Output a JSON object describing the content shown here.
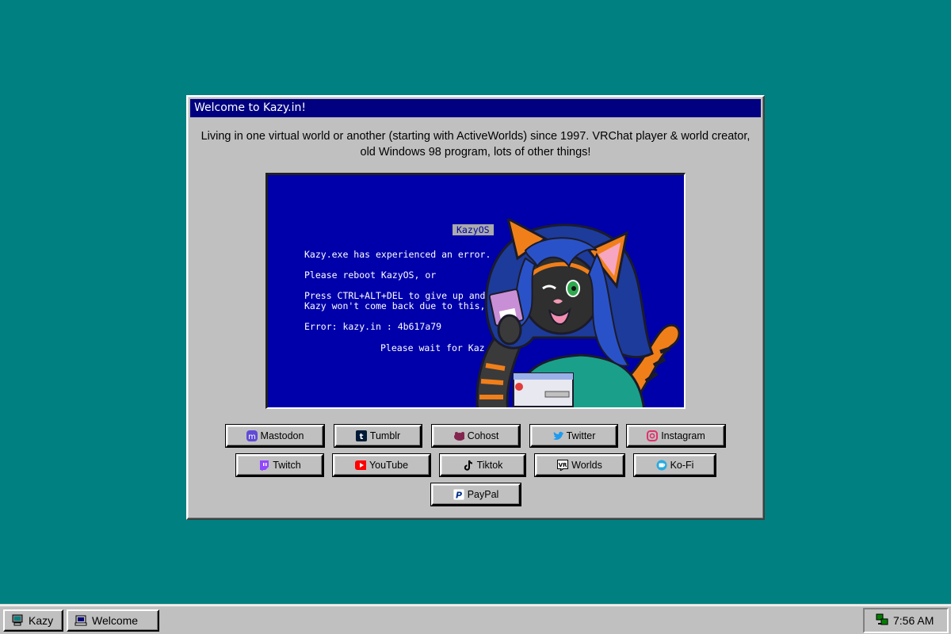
{
  "window": {
    "title": "Welcome to Kazy.in!",
    "intro": "Living in one virtual world or another (starting with ActiveWorlds) since 1997. VRChat player & world creator, old Windows 98 program, lots of other things!"
  },
  "screen": {
    "header": "KazyOS",
    "line1": "Kazy.exe has experienced an error.",
    "line2": "Please reboot KazyOS, or",
    "line3": "Press CTRL+ALT+DEL to give up and r",
    "line4": "Kazy won't come back due to this, bu",
    "line5": "Error: kazy.in : 4b617a79",
    "line6": "Please wait for Kaz"
  },
  "links": [
    {
      "label": "Mastodon",
      "icon": "mastodon-icon",
      "color": "#5f4bd6"
    },
    {
      "label": "Tumblr",
      "icon": "tumblr-icon",
      "color": "#001935"
    },
    {
      "label": "Cohost",
      "icon": "cohost-icon",
      "color": "#83254f"
    },
    {
      "label": "Twitter",
      "icon": "twitter-icon",
      "color": "#1d9bf0"
    },
    {
      "label": "Instagram",
      "icon": "instagram-icon",
      "color": "#e1306c"
    },
    {
      "label": "Twitch",
      "icon": "twitch-icon",
      "color": "#9146ff"
    },
    {
      "label": "YouTube",
      "icon": "youtube-icon",
      "color": "#ff0000"
    },
    {
      "label": "Tiktok",
      "icon": "tiktok-icon",
      "color": "#000000"
    },
    {
      "label": "Worlds",
      "icon": "vrchat-icon",
      "color": "#000000"
    },
    {
      "label": "Ko-Fi",
      "icon": "kofi-icon",
      "color": "#29abe0"
    },
    {
      "label": "PayPal",
      "icon": "paypal-icon",
      "color": "#003087"
    }
  ],
  "taskbar": {
    "start_label": "Kazy",
    "window_label": "Welcome",
    "clock": "7:56 AM"
  },
  "colors": {
    "desktop": "#008080",
    "titlebar": "#000080",
    "face": "#c0c0c0",
    "bsod": "#0000aa"
  }
}
